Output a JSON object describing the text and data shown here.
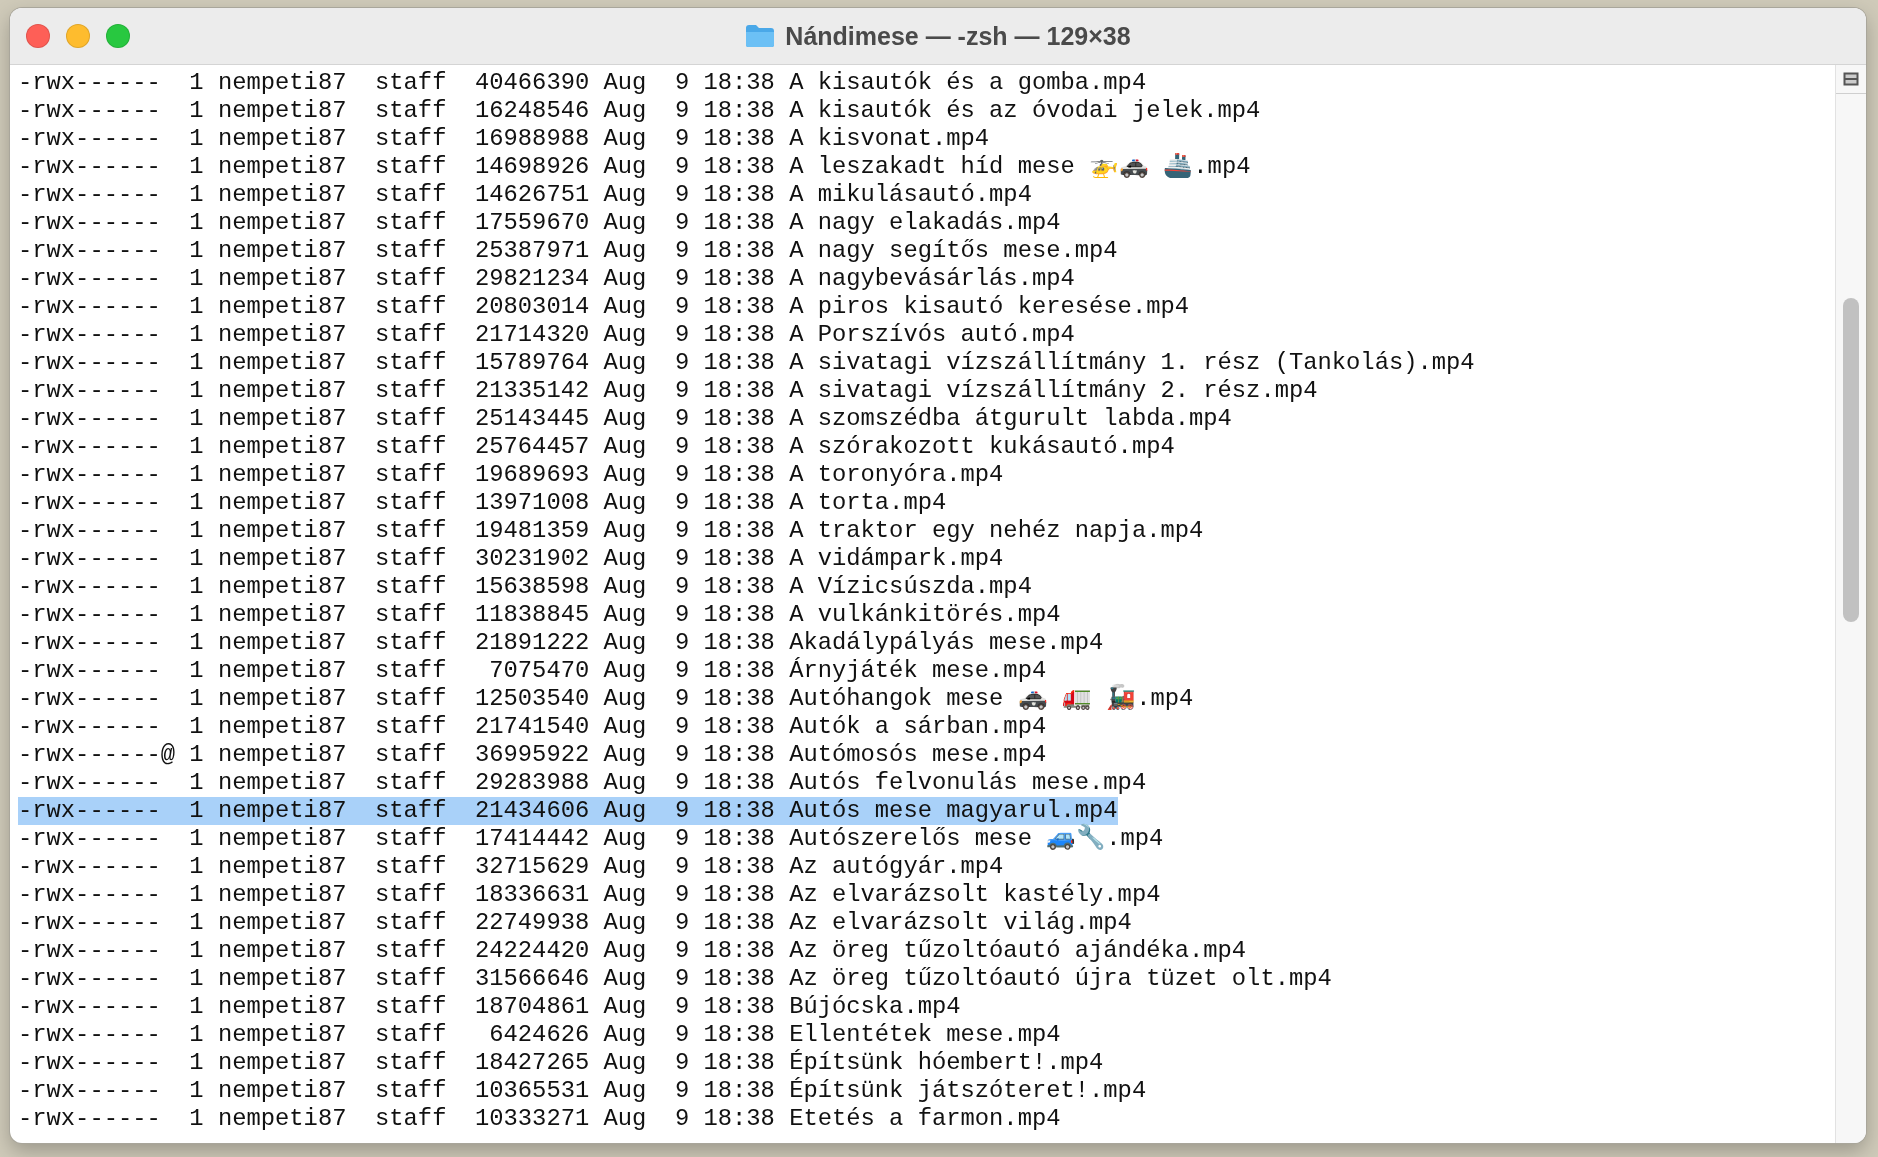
{
  "window": {
    "title": "Nándimese — -zsh — 129×38"
  },
  "lines": [
    {
      "text": "-rwx------  1 nempeti87  staff  40466390 Aug  9 18:38 A kisautók és a gomba.mp4",
      "selected": false
    },
    {
      "text": "-rwx------  1 nempeti87  staff  16248546 Aug  9 18:38 A kisautók és az óvodai jelek.mp4",
      "selected": false
    },
    {
      "text": "-rwx------  1 nempeti87  staff  16988988 Aug  9 18:38 A kisvonat.mp4",
      "selected": false
    },
    {
      "text": "-rwx------  1 nempeti87  staff  14698926 Aug  9 18:38 A leszakadt híd mese 🚁🚓 🚢.mp4",
      "selected": false
    },
    {
      "text": "-rwx------  1 nempeti87  staff  14626751 Aug  9 18:38 A mikulásautó.mp4",
      "selected": false
    },
    {
      "text": "-rwx------  1 nempeti87  staff  17559670 Aug  9 18:38 A nagy elakadás.mp4",
      "selected": false
    },
    {
      "text": "-rwx------  1 nempeti87  staff  25387971 Aug  9 18:38 A nagy segítős mese.mp4",
      "selected": false
    },
    {
      "text": "-rwx------  1 nempeti87  staff  29821234 Aug  9 18:38 A nagybevásárlás.mp4",
      "selected": false
    },
    {
      "text": "-rwx------  1 nempeti87  staff  20803014 Aug  9 18:38 A piros kisautó keresése.mp4",
      "selected": false
    },
    {
      "text": "-rwx------  1 nempeti87  staff  21714320 Aug  9 18:38 A Porszívós autó.mp4",
      "selected": false
    },
    {
      "text": "-rwx------  1 nempeti87  staff  15789764 Aug  9 18:38 A sivatagi vízszállítmány 1. rész (Tankolás).mp4",
      "selected": false
    },
    {
      "text": "-rwx------  1 nempeti87  staff  21335142 Aug  9 18:38 A sivatagi vízszállítmány 2. rész.mp4",
      "selected": false
    },
    {
      "text": "-rwx------  1 nempeti87  staff  25143445 Aug  9 18:38 A szomszédba átgurult labda.mp4",
      "selected": false
    },
    {
      "text": "-rwx------  1 nempeti87  staff  25764457 Aug  9 18:38 A szórakozott kukásautó.mp4",
      "selected": false
    },
    {
      "text": "-rwx------  1 nempeti87  staff  19689693 Aug  9 18:38 A toronyóra.mp4",
      "selected": false
    },
    {
      "text": "-rwx------  1 nempeti87  staff  13971008 Aug  9 18:38 A torta.mp4",
      "selected": false
    },
    {
      "text": "-rwx------  1 nempeti87  staff  19481359 Aug  9 18:38 A traktor egy nehéz napja.mp4",
      "selected": false
    },
    {
      "text": "-rwx------  1 nempeti87  staff  30231902 Aug  9 18:38 A vidámpark.mp4",
      "selected": false
    },
    {
      "text": "-rwx------  1 nempeti87  staff  15638598 Aug  9 18:38 A Vízicsúszda.mp4",
      "selected": false
    },
    {
      "text": "-rwx------  1 nempeti87  staff  11838845 Aug  9 18:38 A vulkánkitörés.mp4",
      "selected": false
    },
    {
      "text": "-rwx------  1 nempeti87  staff  21891222 Aug  9 18:38 Akadálypályás mese.mp4",
      "selected": false
    },
    {
      "text": "-rwx------  1 nempeti87  staff   7075470 Aug  9 18:38 Árnyjáték mese.mp4",
      "selected": false
    },
    {
      "text": "-rwx------  1 nempeti87  staff  12503540 Aug  9 18:38 Autóhangok mese 🚓 🚛 🚂.mp4",
      "selected": false
    },
    {
      "text": "-rwx------  1 nempeti87  staff  21741540 Aug  9 18:38 Autók a sárban.mp4",
      "selected": false
    },
    {
      "text": "-rwx------@ 1 nempeti87  staff  36995922 Aug  9 18:38 Autómosós mese.mp4",
      "selected": false
    },
    {
      "text": "-rwx------  1 nempeti87  staff  29283988 Aug  9 18:38 Autós felvonulás mese.mp4",
      "selected": false
    },
    {
      "text": "-rwx------  1 nempeti87  staff  21434606 Aug  9 18:38 Autós mese magyarul.mp4",
      "selected": true
    },
    {
      "text": "-rwx------  1 nempeti87  staff  17414442 Aug  9 18:38 Autószerelős mese 🚙🔧.mp4",
      "selected": false
    },
    {
      "text": "-rwx------  1 nempeti87  staff  32715629 Aug  9 18:38 Az autógyár.mp4",
      "selected": false
    },
    {
      "text": "-rwx------  1 nempeti87  staff  18336631 Aug  9 18:38 Az elvarázsolt kastély.mp4",
      "selected": false
    },
    {
      "text": "-rwx------  1 nempeti87  staff  22749938 Aug  9 18:38 Az elvarázsolt világ.mp4",
      "selected": false
    },
    {
      "text": "-rwx------  1 nempeti87  staff  24224420 Aug  9 18:38 Az öreg tűzoltóautó ajándéka.mp4",
      "selected": false
    },
    {
      "text": "-rwx------  1 nempeti87  staff  31566646 Aug  9 18:38 Az öreg tűzoltóautó újra tüzet olt.mp4",
      "selected": false
    },
    {
      "text": "-rwx------  1 nempeti87  staff  18704861 Aug  9 18:38 Bújócska.mp4",
      "selected": false
    },
    {
      "text": "-rwx------  1 nempeti87  staff   6424626 Aug  9 18:38 Ellentétek mese.mp4",
      "selected": false
    },
    {
      "text": "-rwx------  1 nempeti87  staff  18427265 Aug  9 18:38 Építsünk hóembert!.mp4",
      "selected": false
    },
    {
      "text": "-rwx------  1 nempeti87  staff  10365531 Aug  9 18:38 Építsünk játszóteret!.mp4",
      "selected": false
    },
    {
      "text": "-rwx------  1 nempeti87  staff  10333271 Aug  9 18:38 Etetés a farmon.mp4",
      "selected": false
    }
  ]
}
